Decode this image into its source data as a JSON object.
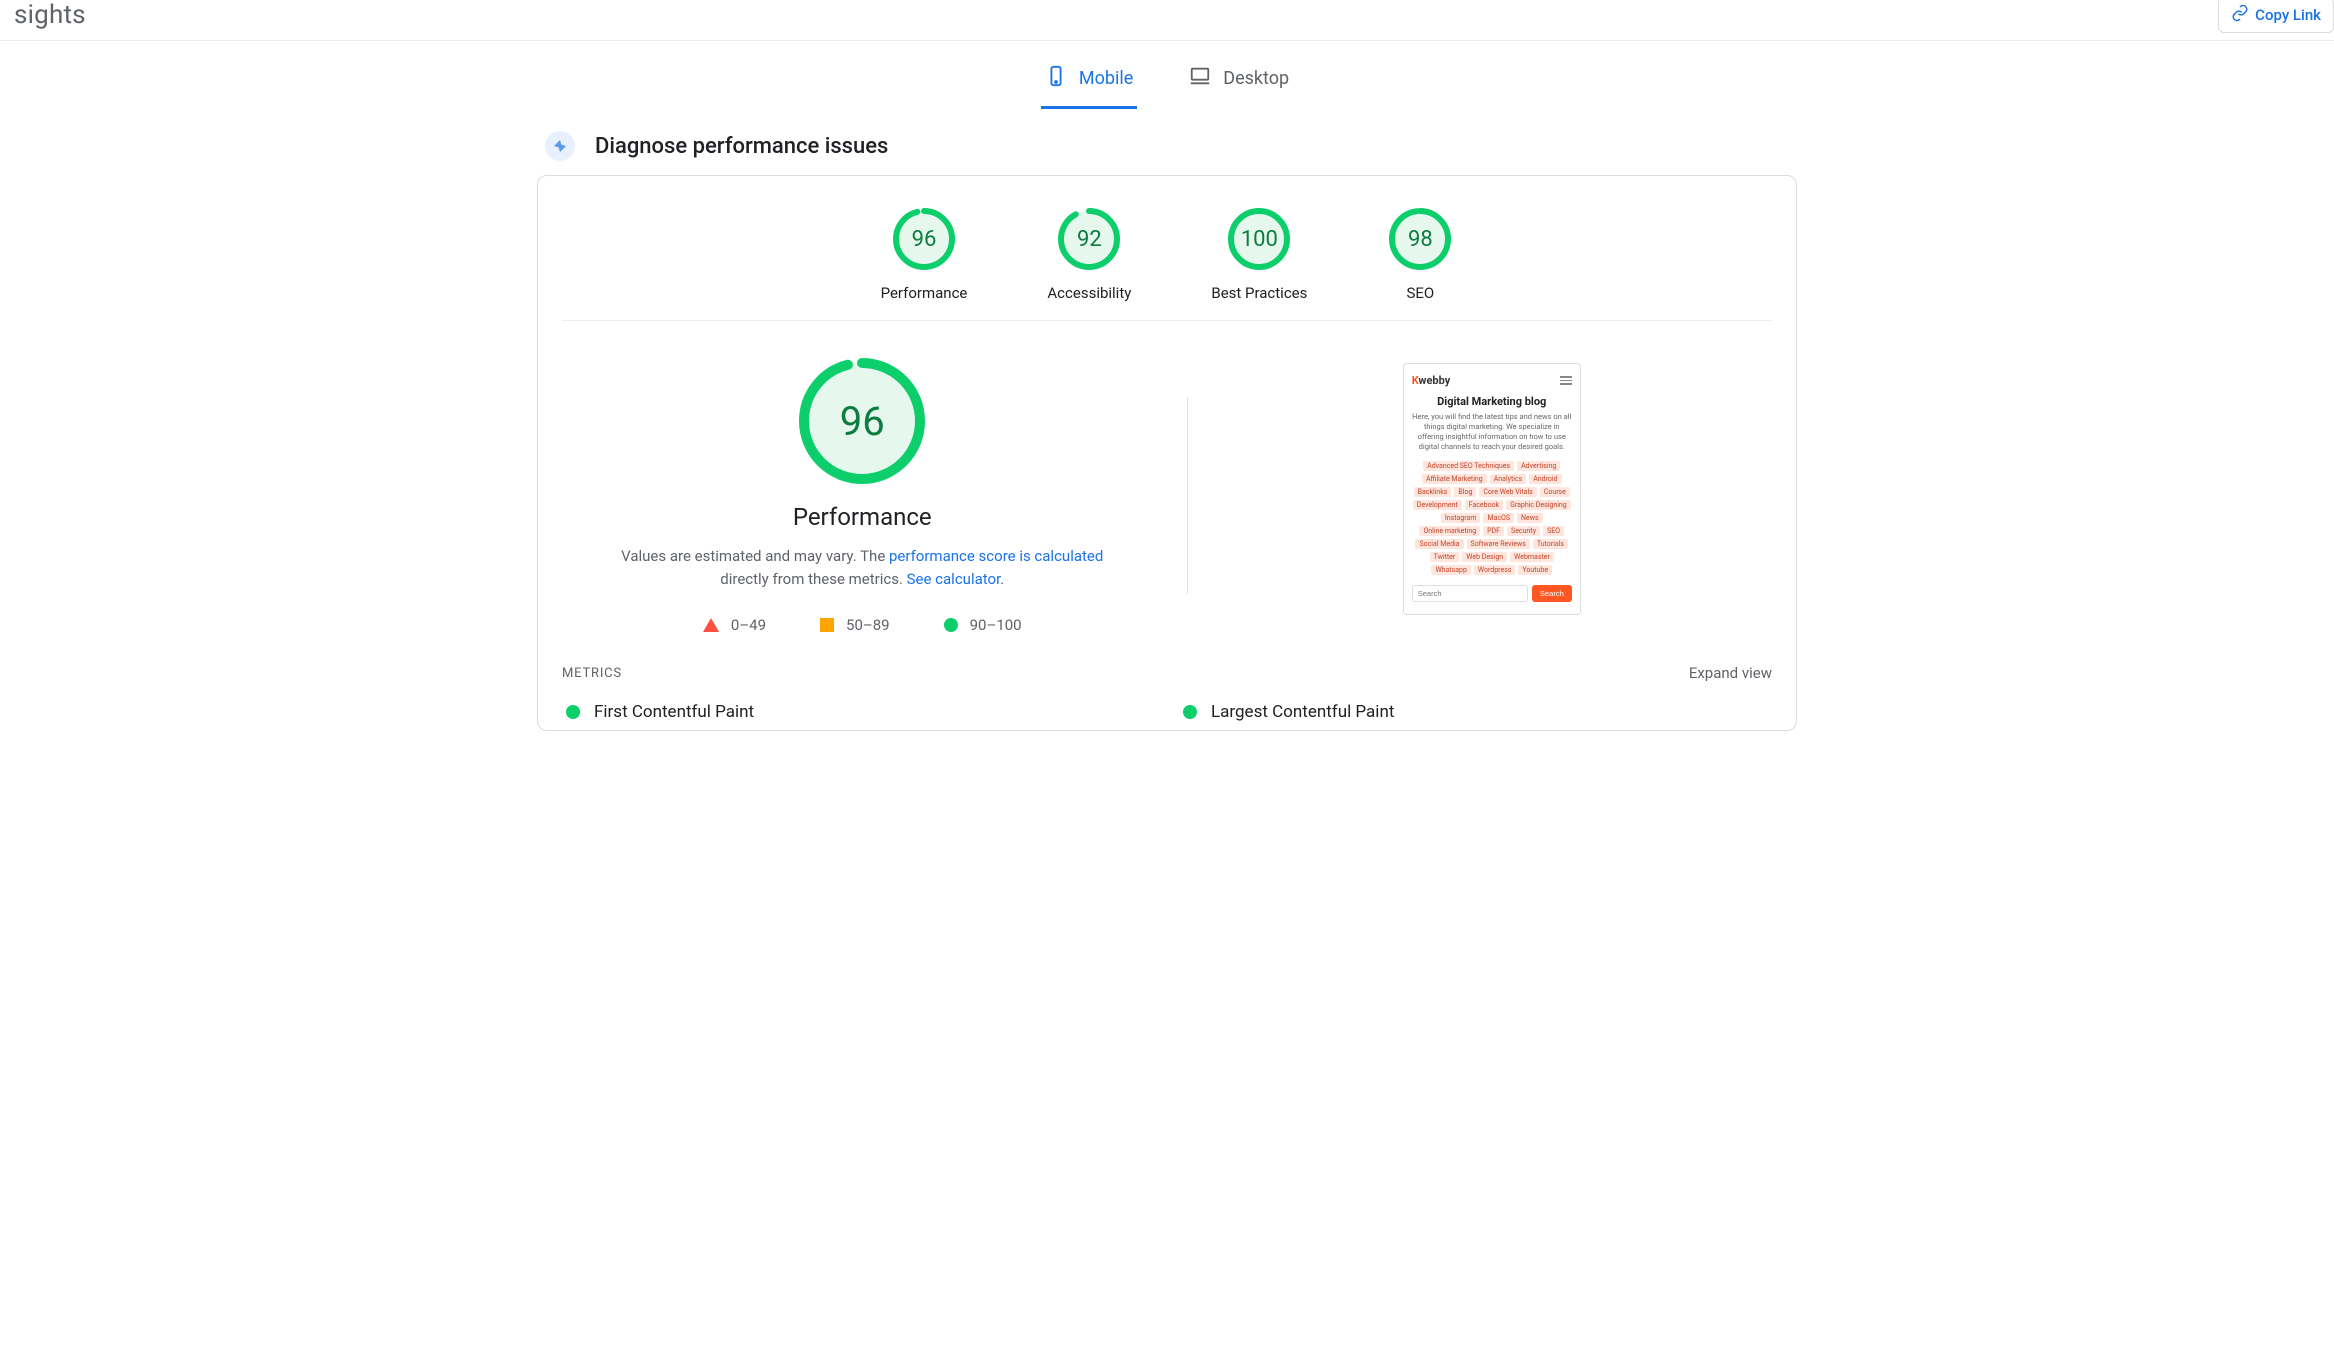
{
  "header": {
    "brand": "sights",
    "copy_link": "Copy Link"
  },
  "tabs": {
    "mobile": "Mobile",
    "desktop": "Desktop",
    "active": "mobile"
  },
  "section": {
    "title": "Diagnose performance issues"
  },
  "gauges": [
    {
      "label": "Performance",
      "value": 96
    },
    {
      "label": "Accessibility",
      "value": 92
    },
    {
      "label": "Best Practices",
      "value": 100
    },
    {
      "label": "SEO",
      "value": 98
    }
  ],
  "performance": {
    "score": 96,
    "title": "Performance",
    "desc_prefix": "Values are estimated and may vary. The ",
    "link1": "performance score is calculated",
    "desc_mid": " directly from these metrics. ",
    "link2": "See calculator",
    "desc_suffix": "."
  },
  "legend": {
    "bad": "0–49",
    "mid": "50–89",
    "good": "90–100"
  },
  "preview": {
    "logo_k": "K",
    "logo_rest": "webby",
    "title": "Digital Marketing blog",
    "sub": "Here, you will find the latest tips and news on all things digital marketing. We specialize in offering insightful information on how to use digital channels to reach your desired goals.",
    "tags": [
      "Advanced SEO Techniques",
      "Advertising",
      "Affiliate Marketing",
      "Analytics",
      "Android",
      "Backlinks",
      "Blog",
      "Core Web Vitals",
      "Course",
      "Development",
      "Facebook",
      "Graphic Designing",
      "Instagram",
      "MacOS",
      "News",
      "Online marketing",
      "PDF",
      "Security",
      "SEO",
      "Social Media",
      "Software Reviews",
      "Tutorials",
      "Twitter",
      "Web Design",
      "Webmaster",
      "Whatsapp",
      "Wordpress",
      "Youtube"
    ],
    "search_placeholder": "Search",
    "search_button": "Search"
  },
  "metrics": {
    "heading": "METRICS",
    "expand": "Expand view",
    "items": [
      {
        "name": "First Contentful Paint",
        "status": "good"
      },
      {
        "name": "Largest Contentful Paint",
        "status": "good"
      }
    ]
  },
  "colors": {
    "green": "#0cce6b"
  }
}
